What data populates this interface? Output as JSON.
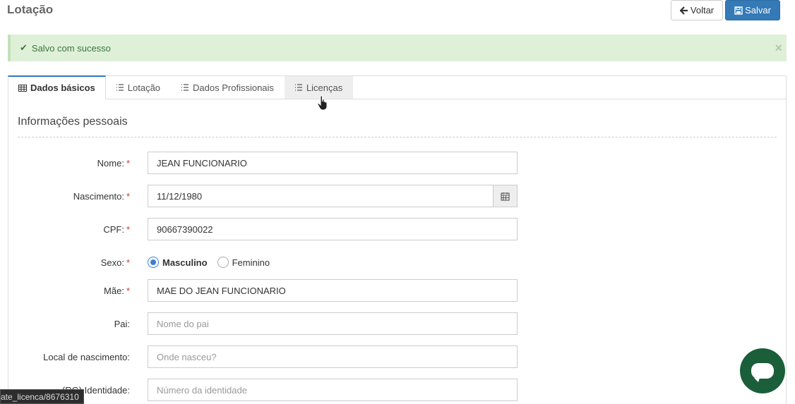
{
  "page": {
    "title": "Lotação"
  },
  "actions": {
    "back_label": "Voltar",
    "save_label": "Salvar"
  },
  "alert": {
    "message": "Salvo com sucesso",
    "close": "×"
  },
  "tabs": [
    {
      "label": "Dados básicos",
      "icon": "table-icon"
    },
    {
      "label": "Lotação",
      "icon": "list-icon"
    },
    {
      "label": "Dados Profissionais",
      "icon": "list-icon"
    },
    {
      "label": "Licenças",
      "icon": "list-icon"
    }
  ],
  "section": {
    "title": "Informações pessoais"
  },
  "form": {
    "nome": {
      "label": "Nome:",
      "value": "JEAN FUNCIONARIO"
    },
    "nascimento": {
      "label": "Nascimento:",
      "value": "11/12/1980"
    },
    "cpf": {
      "label": "CPF:",
      "value": "90667390022"
    },
    "sexo": {
      "label": "Sexo:",
      "option_1": "Masculino",
      "option_2": "Feminino",
      "selected": "Masculino"
    },
    "mae": {
      "label": "Mãe:",
      "value": "MAE DO JEAN FUNCIONARIO"
    },
    "pai": {
      "label": "Pai:",
      "placeholder": "Nome do pai"
    },
    "local_nascimento": {
      "label": "Local de nascimento:",
      "placeholder": "Onde nasceu?"
    },
    "identidade": {
      "label": "(RG) Identidade:",
      "placeholder": "Número da identidade"
    },
    "required_mark": "*"
  },
  "status_bar": {
    "url": "ate_licenca/8676310"
  },
  "colors": {
    "primary": "#337ab7",
    "success_bg": "#dff0d8",
    "success_text": "#3c763d",
    "chat_button": "#1b5e3a"
  }
}
